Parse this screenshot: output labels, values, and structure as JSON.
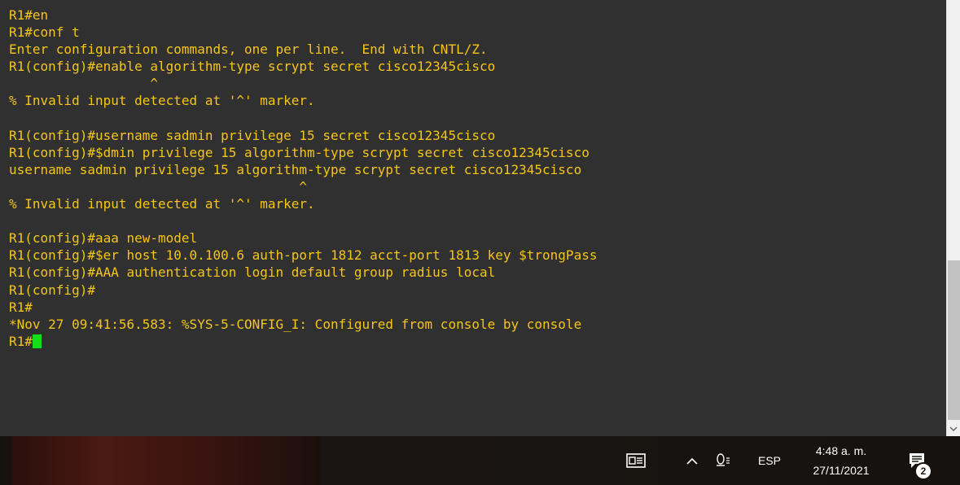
{
  "terminal": {
    "lines": [
      "R1#en",
      "R1#conf t",
      "Enter configuration commands, one per line.  End with CNTL/Z.",
      "R1(config)#enable algorithm-type scrypt secret cisco12345cisco",
      "                  ^",
      "% Invalid input detected at '^' marker.",
      "",
      "R1(config)#username sadmin privilege 15 secret cisco12345cisco",
      "R1(config)#$dmin privilege 15 algorithm-type scrypt secret cisco12345cisco",
      "username sadmin privilege 15 algorithm-type scrypt secret cisco12345cisco",
      "                                     ^",
      "% Invalid input detected at '^' marker.",
      "",
      "R1(config)#aaa new-model",
      "R1(config)#$er host 10.0.100.6 auth-port 1812 acct-port 1813 key $trongPass",
      "R1(config)#AAA authentication login default group radius local",
      "R1(config)#",
      "R1#",
      "*Nov 27 09:41:56.583: %SYS-5-CONFIG_I: Configured from console by console"
    ],
    "prompt": "R1#",
    "text_color": "#f5c518",
    "background_color": "#303030",
    "cursor_color": "#13e01a"
  },
  "taskbar": {
    "icons": {
      "news": "news-icon",
      "chevron": "chevron-up-icon",
      "ime": "ime-icon",
      "notifications": "notification-icon"
    },
    "language": "ESP",
    "time": "4:48 a. m.",
    "date": "27/11/2021",
    "notification_count": "2"
  }
}
